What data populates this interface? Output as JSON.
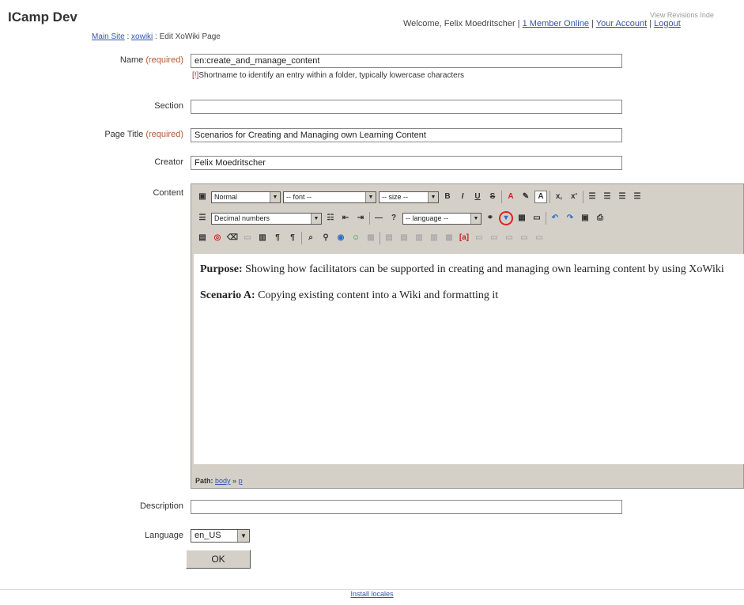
{
  "header": {
    "site_title": "ICamp Dev",
    "breadcrumb": {
      "main_site": "Main Site",
      "sep1": " : ",
      "xowiki": "xowiki",
      "sep2": " : ",
      "current": "Edit XoWiki Page"
    },
    "welcome_text": "Welcome, Felix Moedritscher",
    "members_online": "1 Member Online",
    "your_account": "Your Account",
    "logout": "Logout",
    "top_links": "View  Revisions  Inde"
  },
  "form": {
    "name_label": "Name",
    "required_tag": "(required)",
    "name_value": "en:create_and_manage_content",
    "name_hint_marker": "[!]",
    "name_hint": "Shortname to identify an entry within a folder, typically lowercase characters",
    "section_label": "Section",
    "section_value": "",
    "page_title_label": "Page Title",
    "page_title_value": "Scenarios for Creating and Managing own Learning Content",
    "creator_label": "Creator",
    "creator_value": "Felix Moedritscher",
    "content_label": "Content",
    "description_label": "Description",
    "description_value": "",
    "language_label": "Language",
    "language_value": "en_US",
    "ok_label": "OK"
  },
  "editor": {
    "format_select": "Normal",
    "font_select": "-- font --",
    "size_select": "-- size --",
    "list_select": "Decimal numbers",
    "language_select": "-- language --",
    "content": {
      "p1_bold": "Purpose:",
      "p1_text": " Showing how facilitators can be supported in creating and managing own learning content by using XoWiki",
      "p2_bold": "Scenario A:",
      "p2_text": " Copying existing content into a Wiki and formatting it"
    },
    "path_label": "Path:",
    "path_body": "body",
    "path_sep": " » ",
    "path_p": "p"
  },
  "footer": {
    "install_locales": "Install locales"
  },
  "colors": {
    "required": "#b15b36",
    "link": "#3355aa",
    "highlight_ring": "#dd2222"
  }
}
